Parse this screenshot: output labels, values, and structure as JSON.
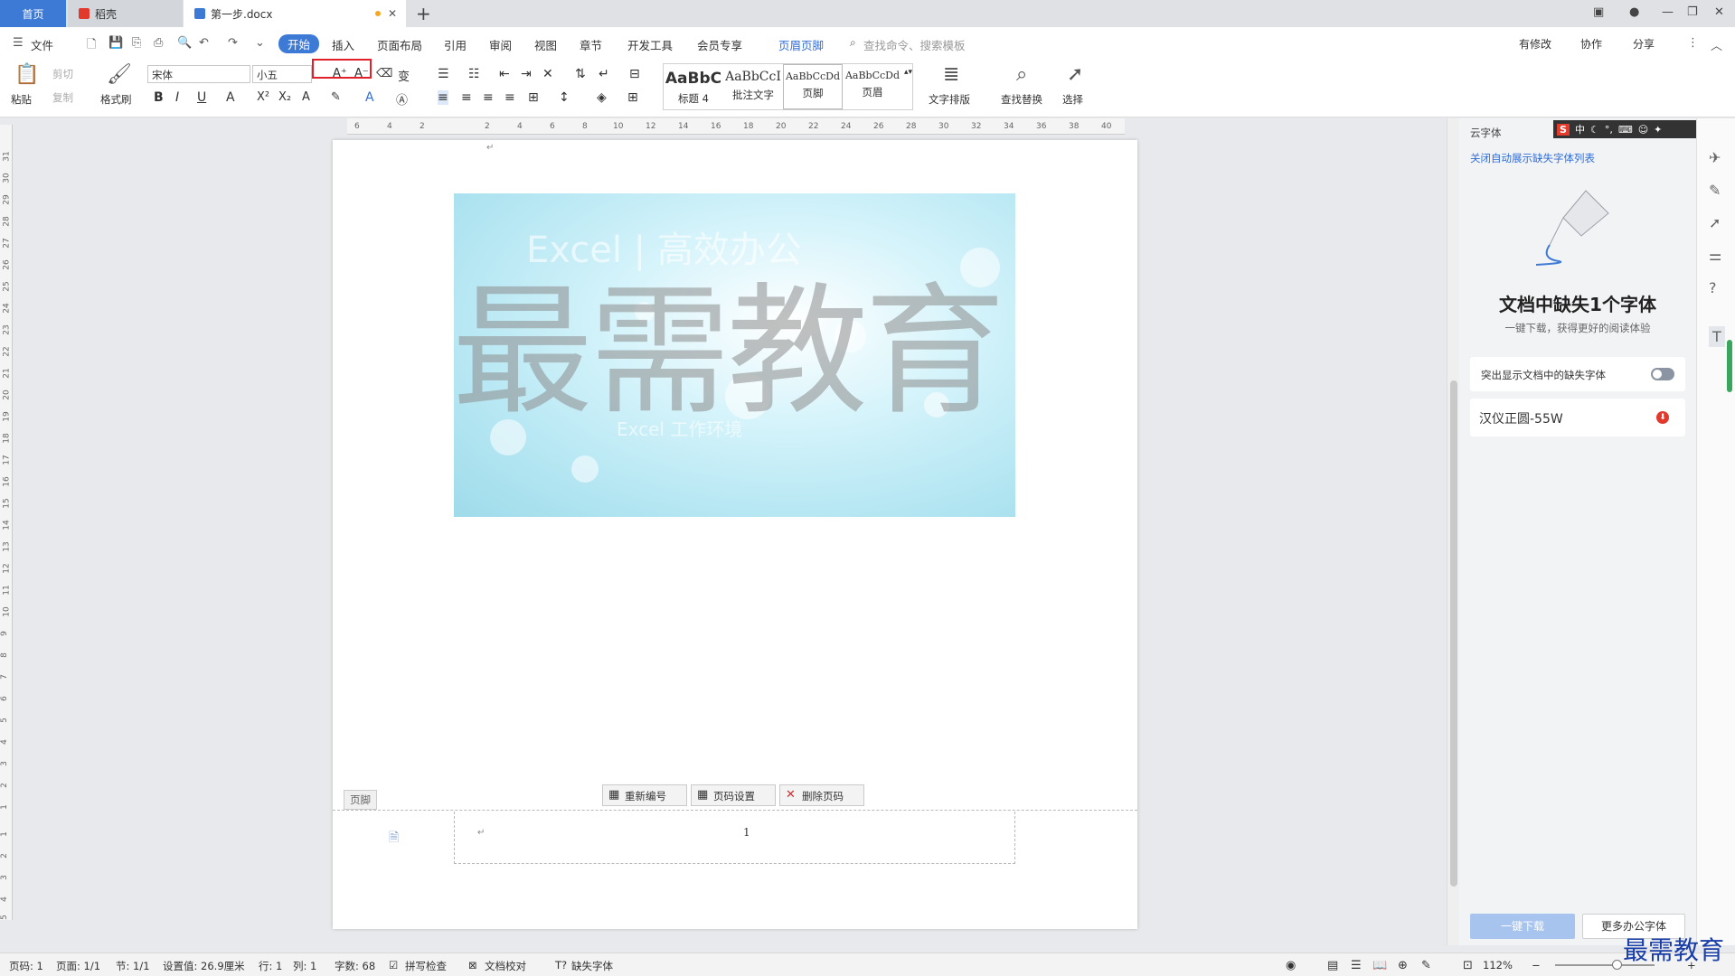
{
  "tabs": {
    "home": "首页",
    "wps": "稻壳",
    "doc": "第一步.docx"
  },
  "menu": {
    "file": "文件",
    "items": [
      "开始",
      "插入",
      "页面布局",
      "引用",
      "审阅",
      "视图",
      "章节",
      "开发工具",
      "会员专享",
      "页眉页脚"
    ],
    "search_placeholder": "查找命令、搜索模板",
    "right": [
      "有修改",
      "协作",
      "分享"
    ]
  },
  "ribbon": {
    "paste": "粘贴",
    "cut": "剪切",
    "copy": "复制",
    "format_painter": "格式刷",
    "font_name": "宋体",
    "font_size": "小五",
    "styles": [
      {
        "sample": "AaBbC",
        "label": "标题 4"
      },
      {
        "sample": "AaBbCcI",
        "label": "批注文字"
      },
      {
        "sample": "AaBbCcDd",
        "label": "页脚"
      },
      {
        "sample": "AaBbCcDd",
        "label": "页眉"
      }
    ],
    "text_layout": "文字排版",
    "find_replace": "查找替换",
    "select": "选择"
  },
  "ruler": {
    "h_ticks": [
      "6",
      "4",
      "2",
      "2",
      "4",
      "6",
      "8",
      "10",
      "12",
      "14",
      "16",
      "18",
      "20",
      "22",
      "24",
      "26",
      "28",
      "30",
      "32",
      "34",
      "36",
      "38",
      "40"
    ],
    "v_ticks": [
      "31",
      "30",
      "29",
      "28",
      "27",
      "26",
      "25",
      "24",
      "23",
      "22",
      "21",
      "20",
      "19",
      "18",
      "17",
      "16",
      "15",
      "14",
      "13",
      "12",
      "11",
      "10",
      "9",
      "8",
      "7",
      "6",
      "5",
      "4",
      "3",
      "2",
      "1",
      "1",
      "2",
      "3",
      "4",
      "5"
    ]
  },
  "document": {
    "watermark": "最需教育",
    "banner_ghost_title": "Excel | 高效办公",
    "banner_ghost_sub": "Excel 工作环境",
    "footer_label": "页脚",
    "footer_buttons": [
      "重新编号",
      "页码设置",
      "删除页码"
    ],
    "page_number": "1"
  },
  "panel": {
    "title": "云字体",
    "link": "关闭自动展示缺失字体列表",
    "heading": "文档中缺失1个字体",
    "sub": "一键下载，获得更好的阅读体验",
    "toggle_label": "突出显示文档中的缺失字体",
    "font_item": "汉仪正圆-55W",
    "download": "一键下载",
    "more_fonts": "更多办公字体"
  },
  "ime": {
    "lang": "中"
  },
  "status": {
    "page_code": "页码: 1",
    "pages": "页面: 1/1",
    "section": "节: 1/1",
    "setting": "设置值: 26.9厘米",
    "row": "行: 1",
    "col": "列: 1",
    "words": "字数: 68",
    "spell": "拼写检查",
    "proof": "文档校对",
    "missing_font": "缺失字体",
    "zoom": "112%"
  },
  "brand": "最需教育",
  "colors": {
    "accent": "#3d7ad6",
    "highlight_box": "#e0202a",
    "toggle": "#8a94a3",
    "brand": "#1a3ea8"
  }
}
